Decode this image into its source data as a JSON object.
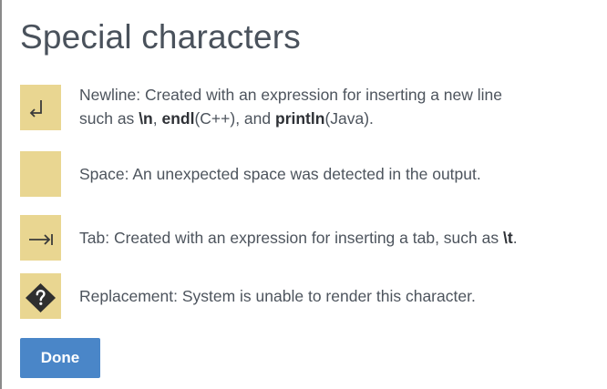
{
  "dialog": {
    "title": "Special characters",
    "done_label": "Done"
  },
  "colors": {
    "swatch": "#e9d691",
    "button": "#4a86c8",
    "text": "#4d545d"
  },
  "characters": [
    {
      "icon": "newline-icon",
      "line1": {
        "t1": "Newline: Created with an expression for inserting a new line"
      },
      "line2": {
        "t1": "such as ",
        "b1": "\\n",
        "t2": ", ",
        "b2": "endl",
        "t3": "(C++), and ",
        "b3": "println",
        "t4": "(Java)."
      }
    },
    {
      "icon": "space-swatch",
      "text": "Space: An unexpected space was detected in the output."
    },
    {
      "icon": "tab-icon",
      "t1": "Tab: Created with an expression for inserting a tab, such as ",
      "b1": "\\t",
      "t2": "."
    },
    {
      "icon": "replacement-icon",
      "text": "Replacement: System is unable to render this character."
    }
  ]
}
